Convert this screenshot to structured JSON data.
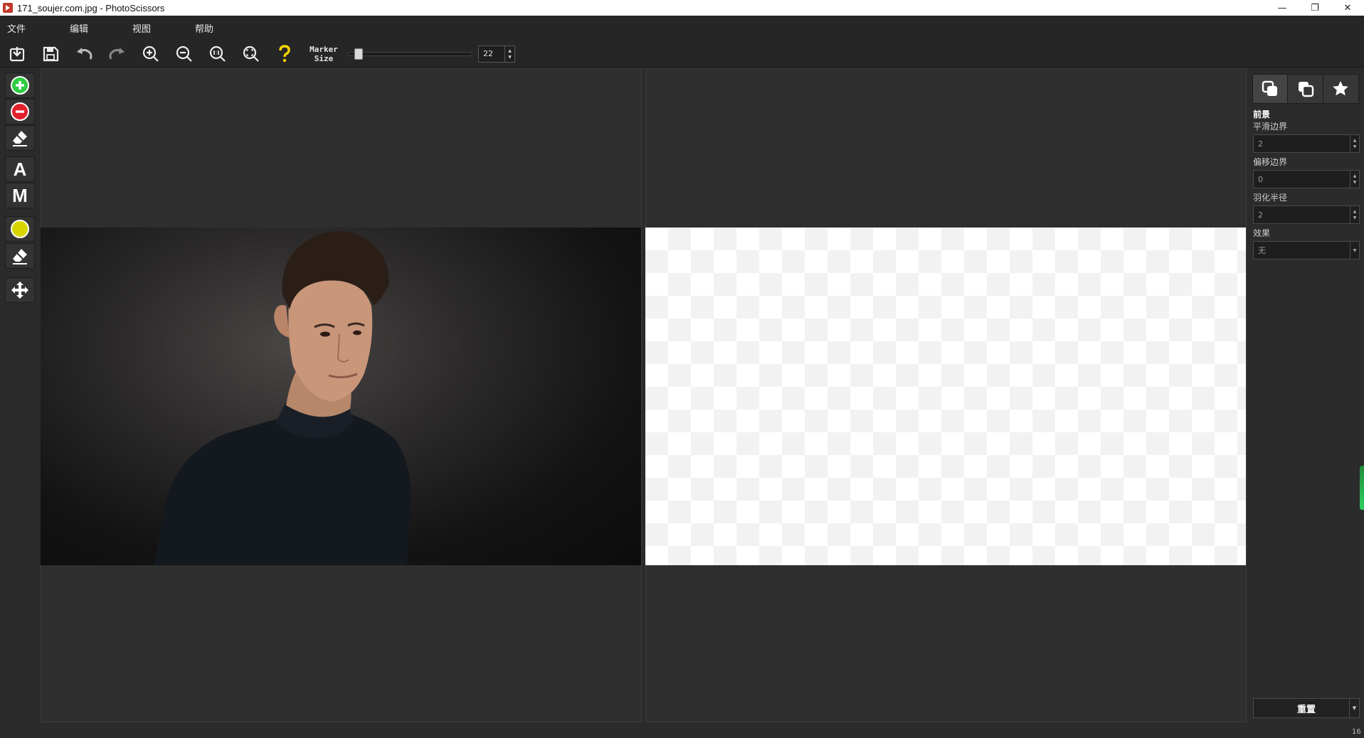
{
  "window": {
    "title": "171_soujer.com.jpg - PhotoScissors",
    "minimize": "—",
    "restore": "❐",
    "close": "✕"
  },
  "menu": [
    "文件",
    "编辑",
    "视图",
    "帮助"
  ],
  "toolbar": {
    "buttons": [
      "open-icon",
      "save-icon",
      "undo-icon",
      "redo-icon",
      "zoom-in-icon",
      "zoom-out-icon",
      "zoom-actual-icon",
      "zoom-fit-icon",
      "help-icon"
    ],
    "marker_label_line1": "Marker",
    "marker_label_line2": "Size",
    "marker_size": "22",
    "marker_fraction": 0.05
  },
  "left_tools": {
    "foreground_marker": "plus-circle-icon",
    "background_marker": "minus-circle-icon",
    "eraser": "eraser-icon",
    "auto_mode": "A",
    "manual_mode": "M",
    "hair_marker": "yellow-circle-icon",
    "hair_eraser": "eraser-icon",
    "move": "move-icon"
  },
  "right_panel": {
    "tabs": [
      "foreground-tab-icon",
      "background-tab-icon",
      "favorites-star-icon"
    ],
    "section_title": "前景",
    "smooth_label": "平滑边界",
    "smooth_value": "2",
    "offset_label": "偏移边界",
    "offset_value": "0",
    "feather_label": "羽化半径",
    "feather_value": "2",
    "effect_label": "效果",
    "effect_value": "无",
    "reset_label": "重置"
  },
  "status": {
    "corner": "16"
  },
  "colors": {
    "accent_green": "#2fcf60",
    "marker_plus": "#2ecc40",
    "marker_minus": "#e0202a",
    "hair_marker": "#d8d400",
    "help": "#f4d400"
  }
}
